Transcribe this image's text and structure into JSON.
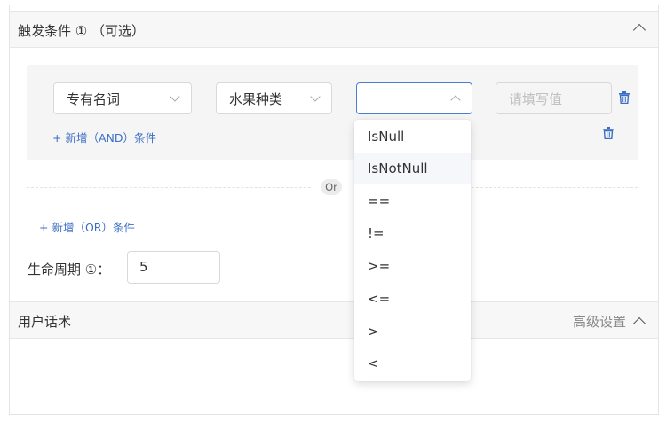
{
  "trigger_panel": {
    "title": "触发条件 ① （可选）"
  },
  "condition_group": {
    "field_select": {
      "value": "专有名词"
    },
    "value_type_select": {
      "value": "水果种类"
    },
    "operator_select": {
      "value": ""
    },
    "value_input": {
      "placeholder": "请填写值"
    },
    "add_and_label": "+ 新增（AND）条件"
  },
  "or_divider_label": "Or",
  "add_or_label": "+ 新增（OR）条件",
  "lifecycle": {
    "label": "生命周期 ①：",
    "value": "5"
  },
  "user_script_panel": {
    "title": "用户话术",
    "advanced_label": "高级设置"
  },
  "operator_options": [
    "IsNull",
    "IsNotNull",
    "==",
    "!=",
    ">=",
    "<=",
    ">",
    "<"
  ],
  "colors": {
    "accent": "#4a7fd0",
    "link": "#3b6fc4",
    "header_bg": "#f7f7f7",
    "condition_bg": "#f5f5f5"
  }
}
